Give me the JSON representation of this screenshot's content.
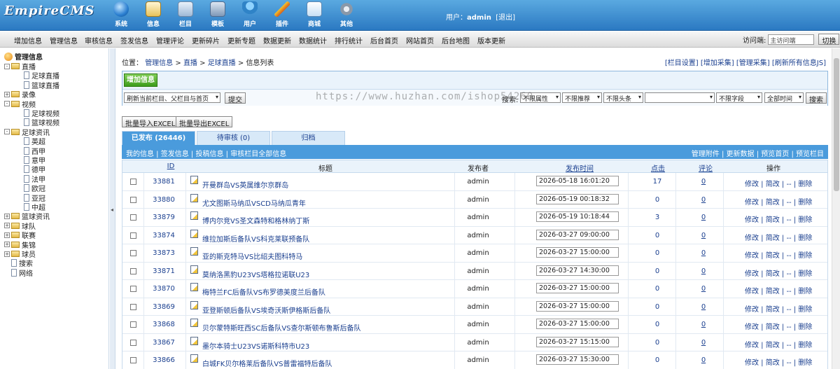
{
  "header": {
    "logo": "EmpireCMS",
    "nav": [
      {
        "label": "系统",
        "icon": "globe-icon"
      },
      {
        "label": "信息",
        "icon": "document-icon"
      },
      {
        "label": "栏目",
        "icon": "folder-icon"
      },
      {
        "label": "模板",
        "icon": "template-icon"
      },
      {
        "label": "用户",
        "icon": "user-icon"
      },
      {
        "label": "插件",
        "icon": "plugin-icon"
      },
      {
        "label": "商城",
        "icon": "shop-icon"
      },
      {
        "label": "其他",
        "icon": "gear-icon"
      }
    ],
    "user_label": "用户：",
    "username": "admin",
    "logout": "[退出]"
  },
  "menubar": {
    "items": [
      "增加信息",
      "管理信息",
      "审核信息",
      "签发信息",
      "管理评论",
      "更新碎片",
      "更新专题",
      "数据更新",
      "数据统计",
      "排行统计",
      "后台首页",
      "网站首页",
      "后台地图",
      "版本更新"
    ],
    "visit_label": "访问端:",
    "visit_value": "主访问端",
    "switch_button": "切换"
  },
  "sidebar": {
    "root": "管理信息",
    "items": [
      {
        "label": "直播",
        "type": "folder",
        "toggle": "-",
        "level": 0
      },
      {
        "label": "足球直播",
        "type": "page",
        "level": 1
      },
      {
        "label": "篮球直播",
        "type": "page",
        "level": 1
      },
      {
        "label": "录像",
        "type": "folder",
        "toggle": "+",
        "level": 0
      },
      {
        "label": "视频",
        "type": "folder",
        "toggle": "-",
        "level": 0
      },
      {
        "label": "足球视频",
        "type": "page",
        "level": 1
      },
      {
        "label": "篮球视频",
        "type": "page",
        "level": 1
      },
      {
        "label": "足球资讯",
        "type": "folder",
        "toggle": "-",
        "level": 0
      },
      {
        "label": "英超",
        "type": "page",
        "level": 1
      },
      {
        "label": "西甲",
        "type": "page",
        "level": 1
      },
      {
        "label": "意甲",
        "type": "page",
        "level": 1
      },
      {
        "label": "德甲",
        "type": "page",
        "level": 1
      },
      {
        "label": "法甲",
        "type": "page",
        "level": 1
      },
      {
        "label": "欧冠",
        "type": "page",
        "level": 1
      },
      {
        "label": "亚冠",
        "type": "page",
        "level": 1
      },
      {
        "label": "中超",
        "type": "page",
        "level": 1
      },
      {
        "label": "篮球资讯",
        "type": "folder",
        "toggle": "+",
        "level": 0
      },
      {
        "label": "球队",
        "type": "folder",
        "toggle": "+",
        "level": 0
      },
      {
        "label": "联赛",
        "type": "folder",
        "toggle": "+",
        "level": 0
      },
      {
        "label": "集锦",
        "type": "folder",
        "toggle": "+",
        "level": 0
      },
      {
        "label": "球员",
        "type": "folder",
        "toggle": "+",
        "level": 0
      },
      {
        "label": "搜索",
        "type": "page",
        "level": 0
      },
      {
        "label": "网络",
        "type": "page",
        "level": 0
      }
    ]
  },
  "location": {
    "prefix": "位置：",
    "crumbs": [
      "管理信息",
      "直播",
      "足球直播",
      "信息列表"
    ]
  },
  "toplinks": [
    "[栏目设置]",
    "[增加采集]",
    "[管理采集]",
    "[刷新所有信息JS]"
  ],
  "toolbar": {
    "add_button": "增加信息",
    "refresh_select": "刷新当前栏目、父栏目与首页",
    "submit_button": "提交",
    "search_label": "搜索:",
    "filters": [
      "不限属性",
      "不限推荐",
      "不限头条",
      "不限字段",
      "全部时间"
    ],
    "search_value": "",
    "search_button": "搜索"
  },
  "watermark": "https://www.huzhan.com/ishop54260",
  "export": {
    "import_button": "批量导入EXCEL",
    "export_button": "批量导出EXCEL"
  },
  "tabs": [
    {
      "label": "已发布 (26446)",
      "active": true
    },
    {
      "label": "待审核 (0)",
      "active": false
    },
    {
      "label": "归档",
      "active": false
    }
  ],
  "bluebar": {
    "left": [
      "我的信息",
      "签发信息",
      "投稿信息",
      "审核栏目全部信息"
    ],
    "right": [
      "管理附件",
      "更新数据",
      "预览首页",
      "预览栏目"
    ]
  },
  "table": {
    "headers": {
      "id": "ID",
      "title": "标题",
      "publisher": "发布者",
      "time": "发布时间",
      "clicks": "点击",
      "comments": "评论",
      "actions": "操作"
    },
    "actions": "修改 | 简改 | -- | 删除",
    "rows": [
      {
        "id": "33881",
        "title": "开曼群岛VS英属维尔京群岛",
        "publisher": "admin",
        "time": "2026-05-18 16:01:20",
        "clicks": "17",
        "comments": "0"
      },
      {
        "id": "33880",
        "title": "尤文图斯马纳瓜VSCD马纳瓜青年",
        "publisher": "admin",
        "time": "2026-05-19 00:18:32",
        "clicks": "0",
        "comments": "0"
      },
      {
        "id": "33879",
        "title": "博内尔竞VS圣文森特和格林纳丁斯",
        "publisher": "admin",
        "time": "2026-05-19 10:18:44",
        "clicks": "3",
        "comments": "0"
      },
      {
        "id": "33874",
        "title": "维拉加斯后备队VS科克莱联预备队",
        "publisher": "admin",
        "time": "2026-03-27 09:00:00",
        "clicks": "0",
        "comments": "0"
      },
      {
        "id": "33873",
        "title": "亚的斯克特马VS比绍夫图科特马",
        "publisher": "admin",
        "time": "2026-03-27 15:00:00",
        "clicks": "0",
        "comments": "0"
      },
      {
        "id": "33871",
        "title": "莫纳洛黑豹U23VS塔格拉诺联U23",
        "publisher": "admin",
        "time": "2026-03-27 14:30:00",
        "clicks": "0",
        "comments": "0"
      },
      {
        "id": "33870",
        "title": "梅特兰FC后备队VS布罗德美度兰后备队",
        "publisher": "admin",
        "time": "2026-03-27 15:00:00",
        "clicks": "0",
        "comments": "0"
      },
      {
        "id": "33869",
        "title": "亚登斯顿后备队VS埃奇沃斯伊格斯后备队",
        "publisher": "admin",
        "time": "2026-03-27 15:00:00",
        "clicks": "0",
        "comments": "0"
      },
      {
        "id": "33868",
        "title": "贝尔蒙特斯旺西SC后备队VS查尔斯顿布鲁斯后备队",
        "publisher": "admin",
        "time": "2026-03-27 15:00:00",
        "clicks": "0",
        "comments": "0"
      },
      {
        "id": "33867",
        "title": "墨尔本骑士U23VS诺斯科特市U23",
        "publisher": "admin",
        "time": "2026-03-27 15:15:00",
        "clicks": "0",
        "comments": "0"
      },
      {
        "id": "33866",
        "title": "白城FK贝尔格莱后备队VS普雷福特后备队",
        "publisher": "admin",
        "time": "2026-03-27 15:30:00",
        "clicks": "0",
        "comments": "0"
      }
    ]
  },
  "colors": {
    "header": "#2b79c2",
    "accent": "#4a9bdc",
    "add_button": "#3d9c1b"
  }
}
